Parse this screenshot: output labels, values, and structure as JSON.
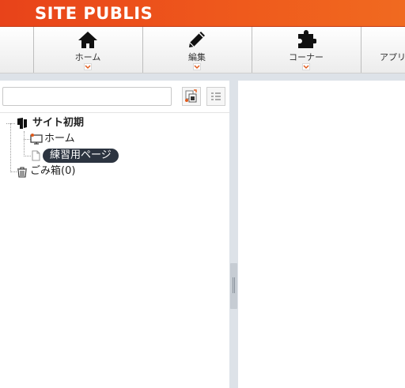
{
  "brand": {
    "title": "SITE PUBLIS"
  },
  "toolbar": {
    "items": [
      {
        "label": "ホーム",
        "icon": "home-icon"
      },
      {
        "label": "編集",
        "icon": "pencil-icon"
      },
      {
        "label": "コーナー",
        "icon": "puzzle-icon"
      },
      {
        "label": "アプリ",
        "icon": "app-icon"
      }
    ]
  },
  "sidebar": {
    "search": {
      "value": "",
      "placeholder": ""
    },
    "tree": {
      "root": "サイト初期",
      "children": [
        {
          "label": "ホーム",
          "icon": "home-page-icon"
        },
        {
          "label": "練習用ページ",
          "icon": "page-icon",
          "selected": true
        }
      ],
      "trash": "ごみ箱(0)"
    }
  },
  "colors": {
    "brand": "#ef5a1c",
    "selection": "#2c3440",
    "panel": "#dde2e8"
  }
}
